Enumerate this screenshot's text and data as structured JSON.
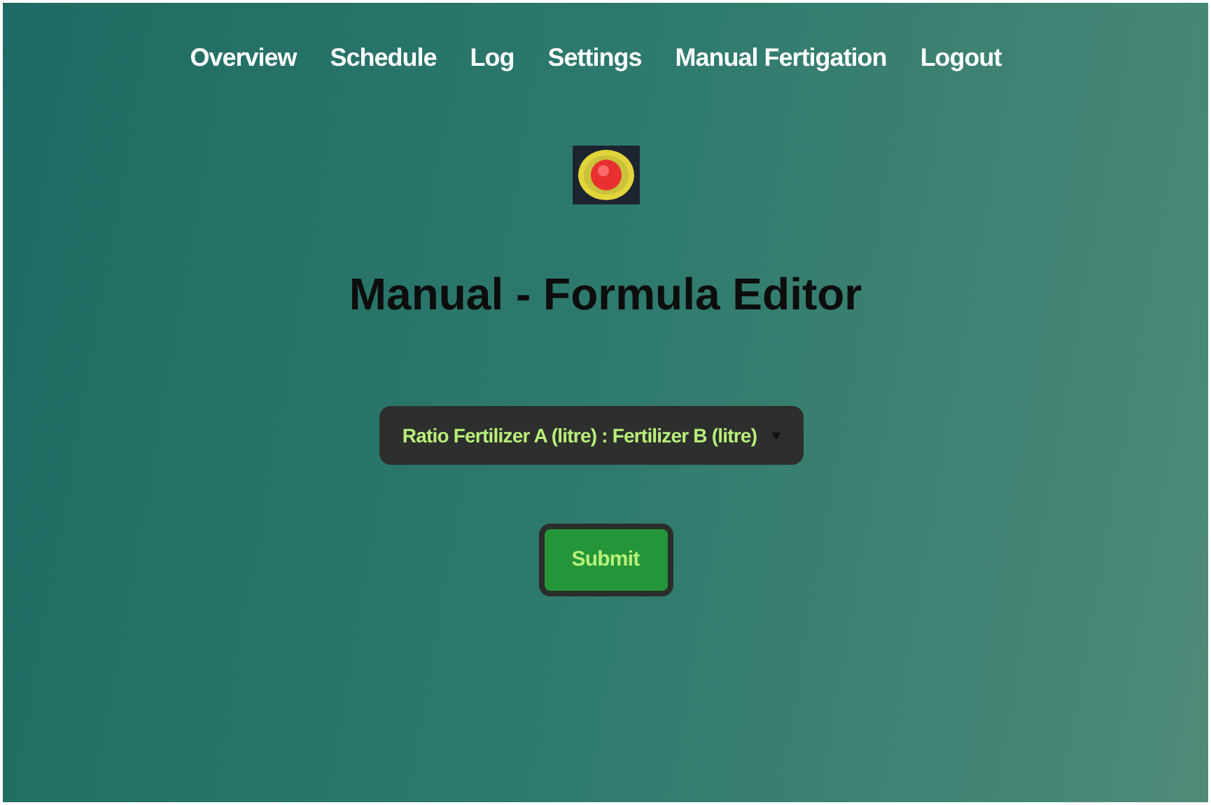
{
  "nav": [
    {
      "label": "Overview"
    },
    {
      "label": "Schedule"
    },
    {
      "label": "Log"
    },
    {
      "label": "Settings"
    },
    {
      "label": "Manual Fertigation"
    },
    {
      "label": "Logout"
    }
  ],
  "title": "Manual - Formula Editor",
  "formula_select": {
    "value": "Ratio Fertilizer A (litre) : Fertilizer B (litre)"
  },
  "submit_button": {
    "label": "Submit"
  }
}
